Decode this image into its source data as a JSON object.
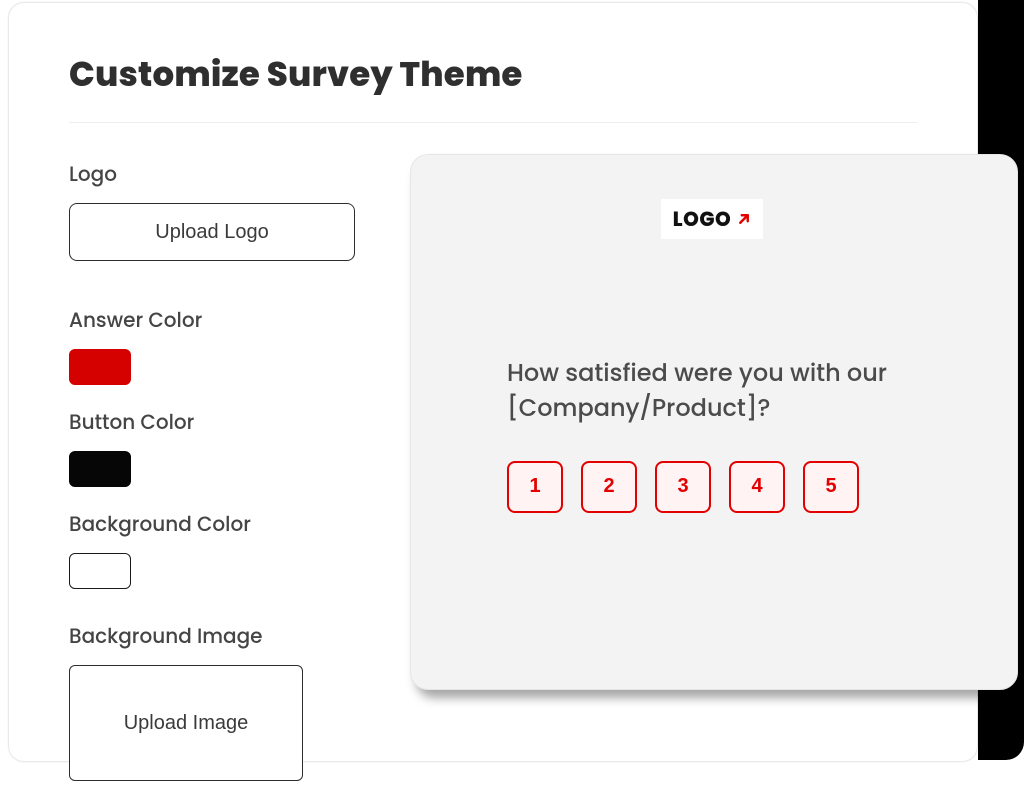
{
  "panel": {
    "title": "Customize Survey Theme"
  },
  "controls": {
    "logo_label": "Logo",
    "upload_logo_label": "Upload Logo",
    "answer_color_label": "Answer Color",
    "answer_color_value": "#d50000",
    "button_color_label": "Button Color",
    "button_color_value": "#060606",
    "background_color_label": "Background Color",
    "background_color_value": "#ffffff",
    "background_image_label": "Background Image",
    "upload_image_label": "Upload Image"
  },
  "preview": {
    "logo_text": "LOGO",
    "question": "How satisfied were you with our [Company/Product]?",
    "ratings": {
      "r1": "1",
      "r2": "2",
      "r3": "3",
      "r4": "4",
      "r5": "5"
    },
    "accent_color": "#e30000"
  }
}
